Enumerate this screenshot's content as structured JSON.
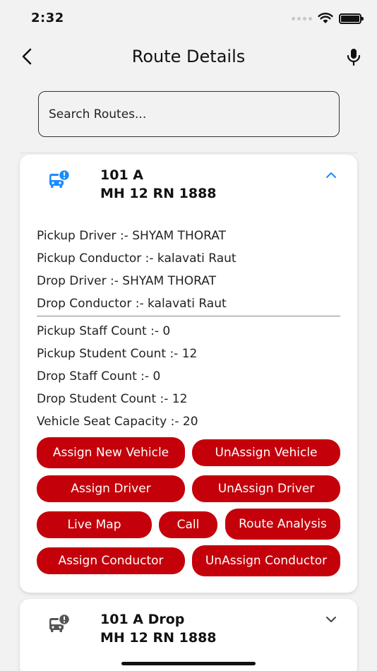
{
  "status_bar": {
    "time": "2:32"
  },
  "nav": {
    "title": "Route Details"
  },
  "search": {
    "placeholder": "Search Routes..."
  },
  "colors": {
    "accent": "#c4000a",
    "active_icon": "#1a8cff",
    "inactive_icon": "#555555"
  },
  "routes": [
    {
      "name": "101 A",
      "plate": "MH 12 RN 1888",
      "icon": "bus-alert-icon",
      "expanded": true,
      "pickup_driver": "Pickup Driver :- SHYAM THORAT",
      "pickup_conductor": "Pickup Conductor :- kalavati Raut",
      "drop_driver": "Drop Driver :- SHYAM THORAT",
      "drop_conductor": "Drop Conductor :- kalavati Raut",
      "pickup_staff_count": "Pickup Staff Count :- 0",
      "pickup_student_count": "Pickup Student Count :- 12",
      "drop_staff_count": "Drop Staff Count :- 0",
      "drop_student_count": "Drop Student Count :- 12",
      "vehicle_seat_capacity": "Vehicle Seat Capacity :- 20",
      "buttons": {
        "assign_new_vehicle": "Assign New Vehicle",
        "unassign_vehicle": "UnAssign Vehicle",
        "assign_driver": "Assign Driver",
        "unassign_driver": "UnAssign Driver",
        "live_map": "Live Map",
        "call": "Call",
        "route_analysis": "Route Analysis",
        "assign_conductor": "Assign Conductor",
        "unassign_conductor": "UnAssign Conductor"
      }
    },
    {
      "name": "101 A Drop",
      "plate": "MH 12 RN 1888",
      "icon": "bus-alert-icon",
      "expanded": false
    }
  ]
}
